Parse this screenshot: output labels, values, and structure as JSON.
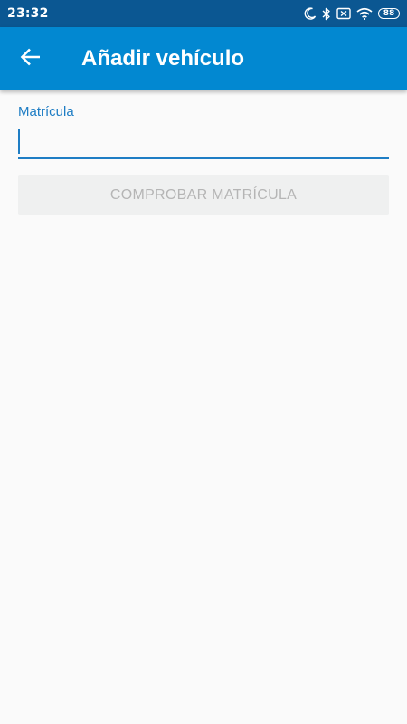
{
  "status_bar": {
    "time": "23:32",
    "battery_level": "88",
    "icons": [
      "moon-icon",
      "bluetooth-icon",
      "sim-off-icon",
      "wifi-icon",
      "battery-icon"
    ],
    "background_color": "#0b5792"
  },
  "app_bar": {
    "title": "Añadir vehículo",
    "back_icon": "arrow-back-icon",
    "background_color": "#0288d1"
  },
  "form": {
    "plate_label": "Matrícula",
    "plate_value": "",
    "accent_color": "#1e7dc4"
  },
  "actions": {
    "check_plate_label": "COMPROBAR MATRÍCULA",
    "check_plate_disabled": true
  }
}
